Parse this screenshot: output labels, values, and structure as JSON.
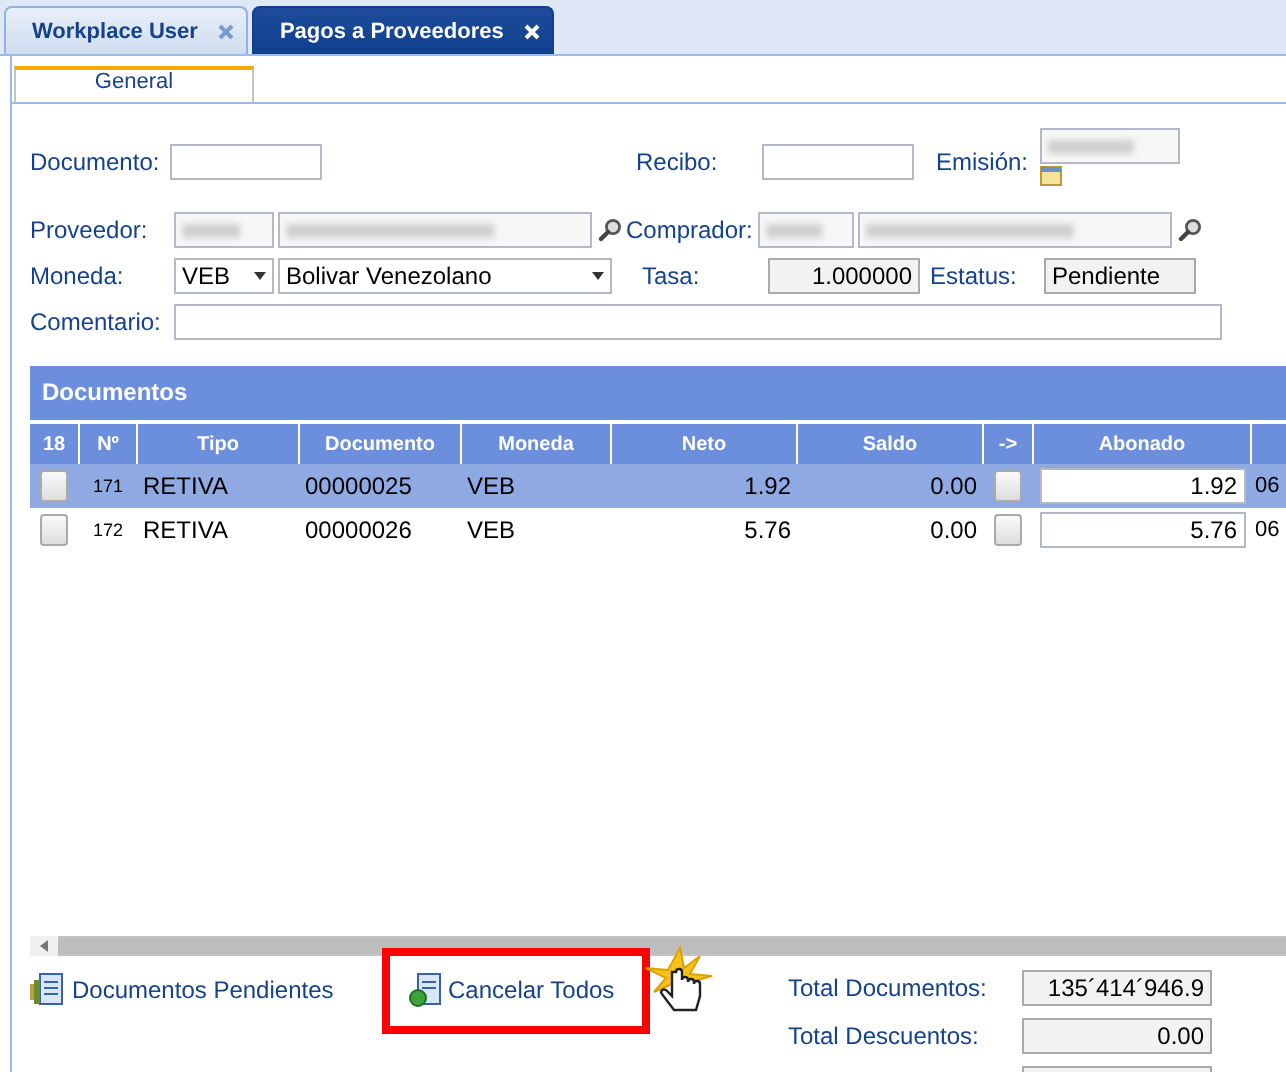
{
  "tabs": [
    {
      "label": "Workplace User",
      "selected": false
    },
    {
      "label": "Pagos a Proveedores",
      "selected": true
    }
  ],
  "subtabs": [
    {
      "label": "General",
      "selected": true
    }
  ],
  "form": {
    "documento": {
      "label": "Documento:"
    },
    "recibo": {
      "label": "Recibo:"
    },
    "emision": {
      "label": "Emisión:"
    },
    "proveedor": {
      "label": "Proveedor:"
    },
    "comprador": {
      "label": "Comprador:"
    },
    "moneda": {
      "label": "Moneda:",
      "code": "VEB",
      "name": "Bolivar Venezolano"
    },
    "tasa": {
      "label": "Tasa:",
      "value": "1.000000"
    },
    "estatus": {
      "label": "Estatus:",
      "value": "Pendiente"
    },
    "comentario": {
      "label": "Comentario:"
    }
  },
  "grid": {
    "title": "Documentos",
    "columns": [
      "18",
      "Nº",
      "Tipo",
      "Documento",
      "Moneda",
      "Neto",
      "Saldo",
      "->",
      "Abonado"
    ],
    "rows": [
      {
        "selected": true,
        "checked": false,
        "no": "171",
        "tipo": "RETIVA",
        "documento": "00000025",
        "moneda": "VEB",
        "neto": "1.92",
        "saldo": "0.00",
        "arrow_checked": false,
        "abonado": "1.92",
        "column_10": "06"
      },
      {
        "selected": false,
        "checked": false,
        "no": "172",
        "tipo": "RETIVA",
        "documento": "00000026",
        "moneda": "VEB",
        "neto": "5.76",
        "saldo": "0.00",
        "arrow_checked": false,
        "abonado": "5.76",
        "column_10": "06"
      }
    ]
  },
  "actions": [
    {
      "label": "Documentos Pendientes",
      "highlighted": false
    },
    {
      "label": "Cancelar Todos",
      "highlighted": true
    }
  ],
  "totals": [
    {
      "label": "Total Documentos:",
      "value": "135´414´946.9"
    },
    {
      "label": "Total Descuentos:",
      "value": "0.00"
    }
  ]
}
